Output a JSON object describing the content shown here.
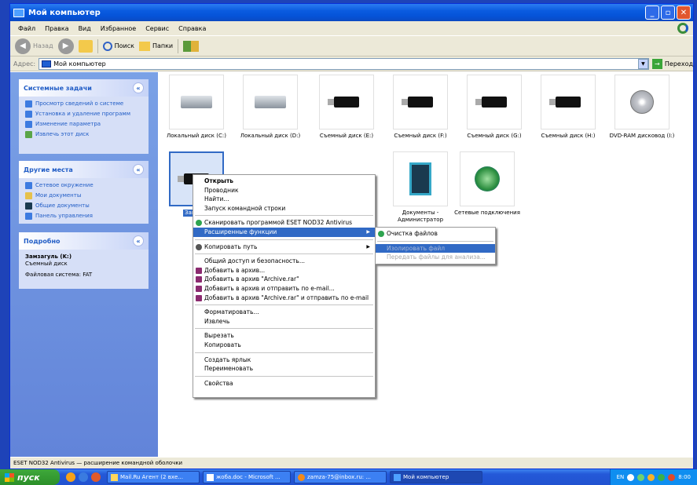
{
  "window": {
    "title": "Мой компьютер"
  },
  "menu": [
    "Файл",
    "Правка",
    "Вид",
    "Избранное",
    "Сервис",
    "Справка"
  ],
  "toolbar": {
    "back": "Назад",
    "search": "Поиск",
    "folders": "Папки"
  },
  "address": {
    "label": "Адрес:",
    "value": "Мой компьютер",
    "go": "Переход"
  },
  "panels": {
    "system": {
      "title": "Системные задачи",
      "items": [
        "Просмотр сведений о системе",
        "Установка и удаление программ",
        "Изменение параметра",
        "Извлечь этот диск"
      ]
    },
    "other": {
      "title": "Другие места",
      "items": [
        "Сетевое окружение",
        "Мои документы",
        "Общие документы",
        "Панель управления"
      ]
    },
    "details": {
      "title": "Подробно",
      "name": "Замзагуль (K:)",
      "type": "Съемный диск",
      "fs": "Файловая система: FAT"
    }
  },
  "items_row1": [
    "Локальный диск (C:)",
    "Локальный диск (D:)",
    "Съемный диск (E:)",
    "Съемный диск (F:)",
    "Съемный диск (G:)",
    "Съемный диск (H:)",
    "DVD-RAM дисковод (I:)"
  ],
  "items_row2": {
    "selected": "Замзагу",
    "docs": "Документы - Администратор",
    "network": "Сетевые подключения"
  },
  "context_menu": {
    "g1": [
      "Открыть",
      "Проводник",
      "Найти...",
      "Запуск командной строки"
    ],
    "eset": "Сканировать программой ESET NOD32 Antivirus",
    "ext": "Расширенные функции",
    "copypath": "Копировать путь",
    "g2": [
      "Общий доступ и безопасность...",
      "Добавить в архив...",
      "Добавить в архив \"Archive.rar\"",
      "Добавить в архив и отправить по e-mail...",
      "Добавить в архив \"Archive.rar\" и отправить по e-mail"
    ],
    "g3": [
      "Форматировать...",
      "Извлечь"
    ],
    "g4": [
      "Вырезать",
      "Копировать"
    ],
    "g5": [
      "Создать ярлык",
      "Переименовать"
    ],
    "g6": [
      "Свойства"
    ]
  },
  "submenu": [
    "Очистка файлов",
    "Изолировать файл",
    "Передать файлы для анализа..."
  ],
  "status": "ESET NOD32 Antivirus — расширение командной оболочки",
  "taskbar": {
    "start": "пуск",
    "buttons": [
      "Mail.Ru Агент (2 вхе...",
      "жоба.doc - Microsoft ...",
      "zamza-75@inbox.ru: ...",
      "Мой компьютер"
    ],
    "lang": "EN",
    "time": "8:00"
  }
}
